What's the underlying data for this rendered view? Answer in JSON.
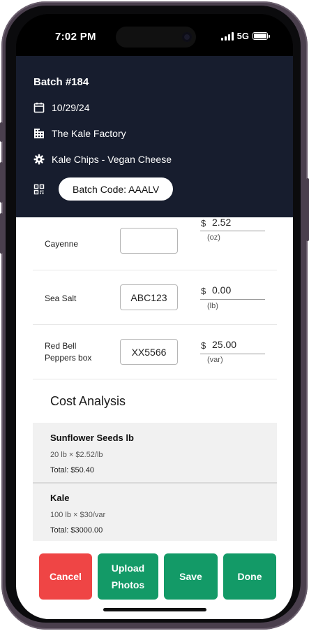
{
  "status_bar": {
    "time": "7:02 PM",
    "network": "5G"
  },
  "header": {
    "batch_title": "Batch #184",
    "date": "10/29/24",
    "factory": "The Kale Factory",
    "product": "Kale Chips - Vegan Cheese",
    "batch_code": "Batch Code: AAALV"
  },
  "ingredients": [
    {
      "name": "Cayenne",
      "code": "",
      "currency": "$",
      "price": "2.52",
      "unit": "(oz)"
    },
    {
      "name": "Sea Salt",
      "code": "ABC123",
      "currency": "$",
      "price": "0.00",
      "unit": "(lb)"
    },
    {
      "name": "Red Bell Peppers box",
      "code": "XX5566",
      "currency": "$",
      "price": "25.00",
      "unit": "(var)"
    }
  ],
  "cost_analysis": {
    "title": "Cost Analysis",
    "items": [
      {
        "name": "Sunflower Seeds lb",
        "detail": "20 lb × $2.52/lb",
        "total": "Total: $50.40"
      },
      {
        "name": "Kale",
        "detail": "100 lb × $30/var",
        "total": "Total: $3000.00"
      }
    ]
  },
  "actions": {
    "cancel": "Cancel",
    "upload": "Upload\nPhotos",
    "save": "Save",
    "done": "Done"
  },
  "colors": {
    "header_bg": "#171d2e",
    "cancel": "#ef4545",
    "primary": "#139a67"
  }
}
